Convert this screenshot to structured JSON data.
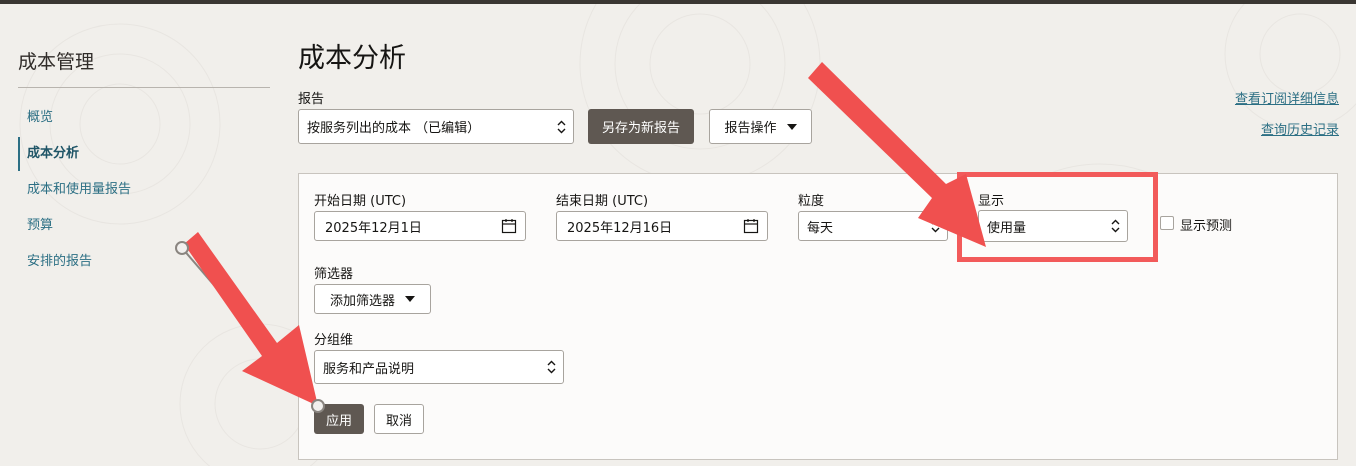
{
  "sidebar": {
    "title": "成本管理",
    "items": [
      {
        "label": "概览",
        "active": false
      },
      {
        "label": "成本分析",
        "active": true
      },
      {
        "label": "成本和使用量报告",
        "active": false
      },
      {
        "label": "预算",
        "active": false
      },
      {
        "label": "安排的报告",
        "active": false
      }
    ]
  },
  "header": {
    "title": "成本分析",
    "report_label": "报告",
    "report_value": "按服务列出的成本 （已编辑）",
    "save_as_new_label": "另存为新报告",
    "report_actions_label": "报告操作",
    "links": [
      "查看订阅详细信息",
      "查询历史记录"
    ]
  },
  "filters": {
    "start_date": {
      "label": "开始日期 (UTC)",
      "value": "2025年12月1日"
    },
    "end_date": {
      "label": "结束日期 (UTC)",
      "value": "2025年12月16日"
    },
    "granularity": {
      "label": "粒度",
      "value": "每天"
    },
    "show": {
      "label": "显示",
      "value": "使用量"
    },
    "forecast": {
      "label": "显示预测",
      "checked": false
    },
    "filter": {
      "label": "筛选器",
      "add_label": "添加筛选器"
    },
    "group_by": {
      "label": "分组维",
      "value": "服务和产品说明"
    },
    "apply_label": "应用",
    "cancel_label": "取消"
  },
  "annotations": {
    "highlight_color": "#f25a5a",
    "arrow_color": "#f0504f"
  }
}
